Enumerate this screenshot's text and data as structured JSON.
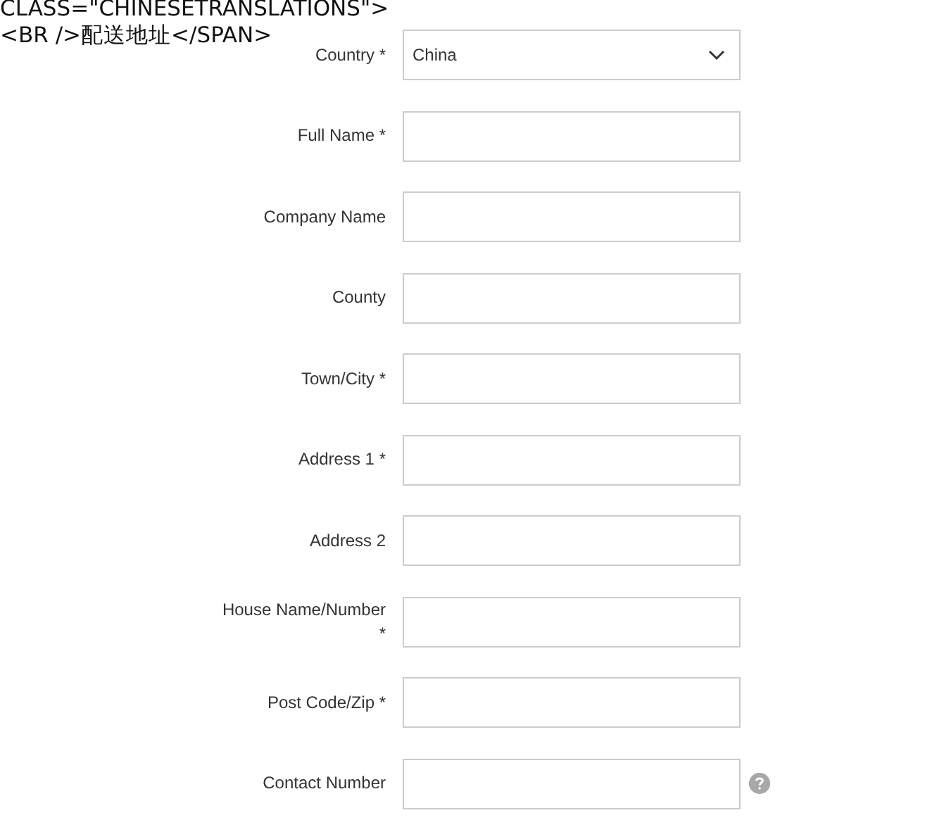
{
  "header_lines": [
    "CLASS=\"CHINESETRANSLATIONS\">",
    "<BR />配送地址</SPAN>"
  ],
  "fields": [
    {
      "kind": "select",
      "label": "Country *",
      "value": "China",
      "help": false
    },
    {
      "kind": "text",
      "label": "Full Name *",
      "help": false
    },
    {
      "kind": "text",
      "label": "Company Name",
      "help": false
    },
    {
      "kind": "text",
      "label": "County",
      "help": false
    },
    {
      "kind": "text",
      "label": "Town/City *",
      "help": false
    },
    {
      "kind": "text",
      "label": "Address 1 *",
      "help": false
    },
    {
      "kind": "text",
      "label": "Address 2",
      "help": false
    },
    {
      "kind": "text",
      "label": "House Name/Number *",
      "help": false
    },
    {
      "kind": "text",
      "label": "Post Code/Zip *",
      "help": false
    },
    {
      "kind": "text",
      "label": "Contact Number",
      "help": true
    }
  ]
}
